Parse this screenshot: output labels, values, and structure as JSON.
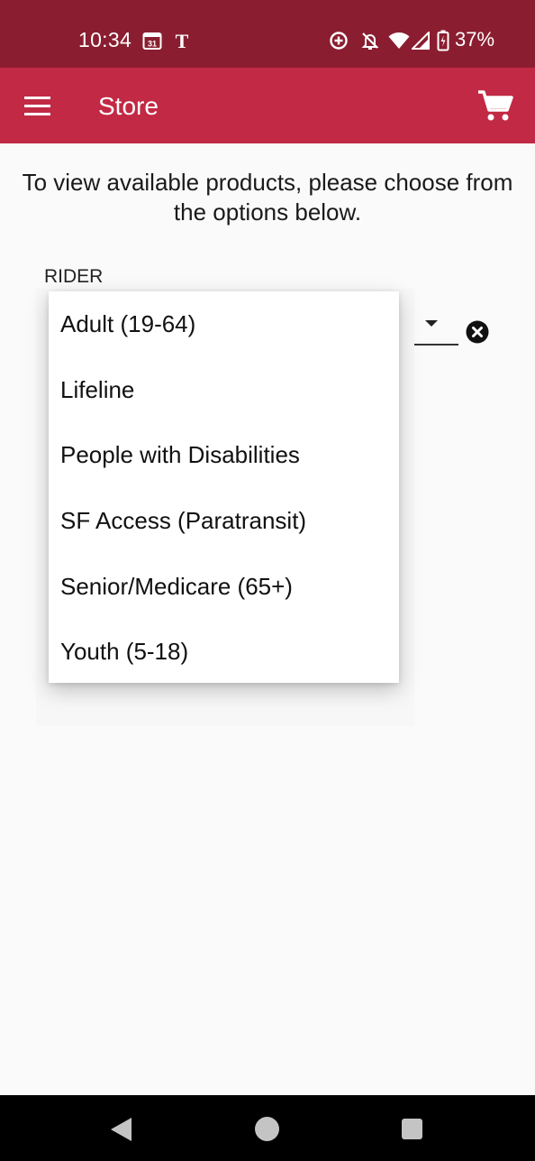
{
  "status_bar": {
    "time": "10:34",
    "calendar_day": "31",
    "battery_percent": "37%",
    "icons": [
      "calendar-icon",
      "nyt-icon",
      "data-saver-icon",
      "mute-icon",
      "wifi-icon",
      "signal-icon",
      "battery-icon"
    ]
  },
  "app_bar": {
    "title": "Store",
    "menu_icon": "hamburger-menu-icon",
    "cart_icon": "shopping-cart-icon",
    "color": "#c22944"
  },
  "content": {
    "intro_text": "To view available products, please choose from the options below.",
    "rider_label": "RIDER"
  },
  "dropdown": {
    "options": [
      "Adult (19-64)",
      "Lifeline",
      "People with Disabilities",
      "SF Access (Paratransit)",
      "Senior/Medicare (65+)",
      "Youth (5-18)"
    ]
  },
  "nav_bar": {
    "icons": [
      "back-icon",
      "home-icon",
      "recents-icon"
    ]
  }
}
